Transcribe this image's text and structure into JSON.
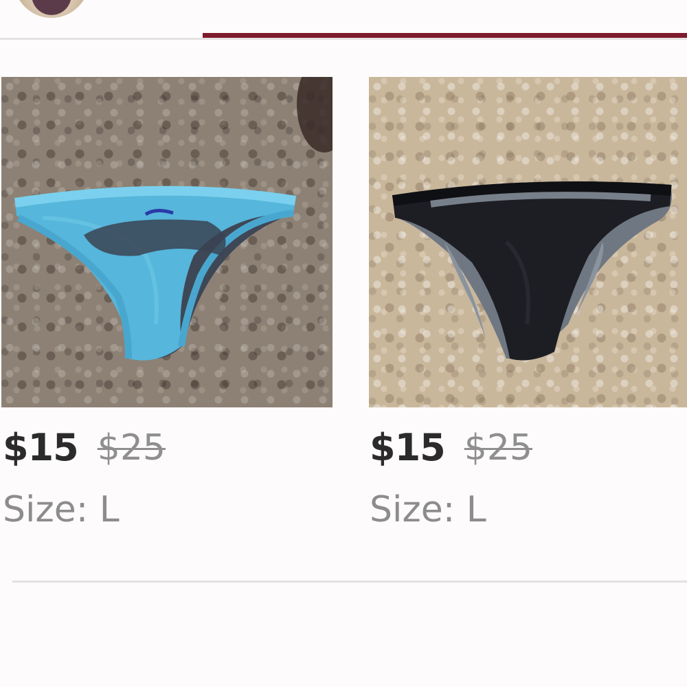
{
  "listings": [
    {
      "price": "$15",
      "original_price": "$25",
      "size_label": "Size:",
      "size_value": "L",
      "item_color": "#4fb6dc"
    },
    {
      "price": "$15",
      "original_price": "$25",
      "size_label": "Size:",
      "size_value": "L",
      "item_color": "#1c1d22"
    }
  ],
  "colors": {
    "accent": "#7d1a2b",
    "price_text": "#2b2b2b",
    "muted_text": "#8c8c8c",
    "divider": "#e5e1e1"
  }
}
